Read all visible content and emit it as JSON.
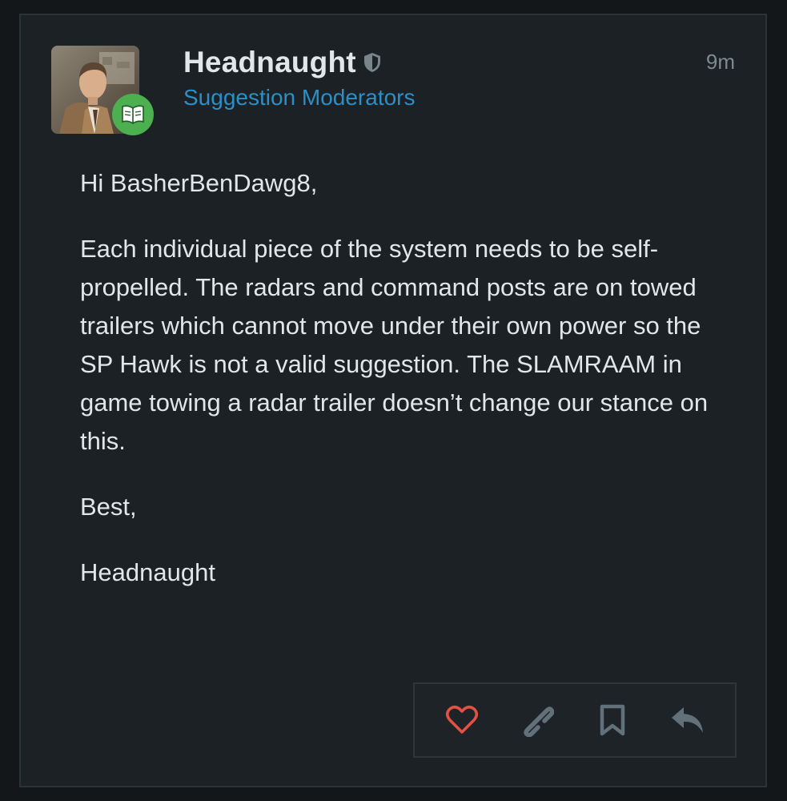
{
  "post": {
    "author": {
      "username": "Headnaught",
      "usergroup": "Suggestion Moderators",
      "avatar_icon": "avatar-portrait",
      "flair_icon": "book-icon",
      "badge_icon": "shield-icon"
    },
    "date": "9m",
    "body": {
      "greeting": "Hi BasherBenDawg8,",
      "paragraph": "Each individual piece of the system needs to be self-propelled. The radars and command posts are on towed trailers which cannot move under their own power so the SP Hawk is not a valid suggestion. The SLAMRAAM in game towing a radar trailer doesn’t change our stance on this.",
      "closing": "Best,",
      "signature": "Headnaught"
    },
    "actions": [
      {
        "icon": "heart-icon",
        "name": "like"
      },
      {
        "icon": "link-icon",
        "name": "share"
      },
      {
        "icon": "bookmark-icon",
        "name": "bookmark"
      },
      {
        "icon": "reply-icon",
        "name": "reply"
      }
    ]
  },
  "colors": {
    "background": "#131719",
    "card": "#1b2124",
    "text": "#e3e6e8",
    "link": "#2b8fc9",
    "muted": "#7f8a90",
    "like": "#e45142",
    "icon": "#617079",
    "flair": "#4caf50"
  }
}
